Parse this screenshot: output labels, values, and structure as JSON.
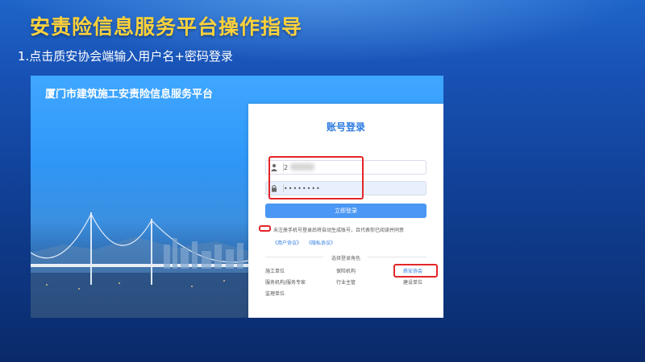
{
  "slide": {
    "title": "安责险信息服务平台操作指导",
    "step": "1.点击质安协会端输入用户名+密码登录"
  },
  "platform": {
    "title": "厦门市建筑施工安责险信息服务平台"
  },
  "login": {
    "title": "账号登录",
    "username_value": "2",
    "password_value": "••••••••",
    "submit_label": "立即登录",
    "agree_text": "未注册手机号登录后将自动生成账号，且代表你已阅读并同意",
    "user_agreement": "《用户协议》",
    "privacy_agreement": "《隐私协议》",
    "role_heading": "选择登录角色",
    "roles": [
      "施工单位",
      "保险机构",
      "质安协会",
      "服务机构/服务专家",
      "行业主管",
      "建设单位",
      "监理单位"
    ]
  },
  "colors": {
    "title_yellow": "#ffd23a",
    "accent_blue": "#2d7be0",
    "highlight_red": "#e3262a"
  },
  "icons": [
    "user-icon",
    "lock-icon"
  ]
}
